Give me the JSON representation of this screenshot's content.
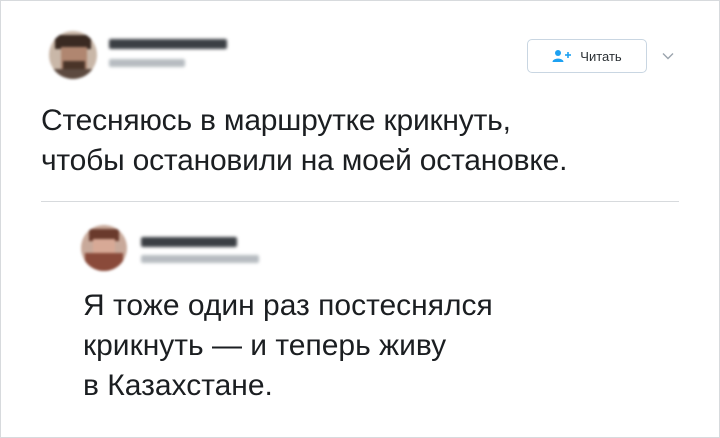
{
  "tweet": {
    "author_name": "",
    "author_handle": "",
    "text_lines": [
      "Стесняюсь в маршрутке крикнуть,",
      "чтобы остановили на моей остановке."
    ]
  },
  "follow_button": {
    "label": "Читать",
    "icon": "add-user-icon",
    "accent": "#1da1f2"
  },
  "menu": {
    "icon": "chevron-down-icon"
  },
  "reply": {
    "author_name": "",
    "author_handle": "",
    "text_lines": [
      "Я тоже один раз постеснялся",
      "крикнуть — и теперь живу",
      "в Казахстане."
    ]
  }
}
